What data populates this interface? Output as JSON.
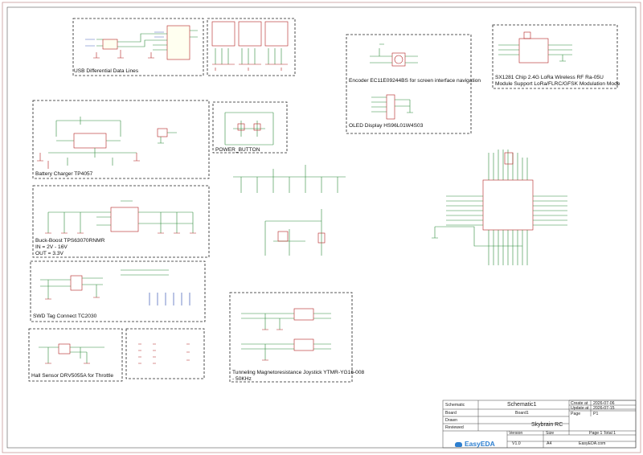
{
  "blocks": {
    "usb": "USB Differential Data Lines",
    "battery": "Battery Charger TP4057",
    "power_button": "POWER_BUTTON",
    "buck_boost_1": "Buck-Boost TPS63070RNMR",
    "buck_boost_2": "IN = 2V - 16V",
    "buck_boost_3": "OUT = 3.3V",
    "swd": "SWD Tag Connect TC2030",
    "hall": "Hall Sensor DRV5055A for Throttle",
    "joystick_1": "Tunneling Magnetoresistance Joystick YTMR-YG16-008",
    "joystick_2": "- 50KHz",
    "encoder": "Encoder EC11E09244BS for screen interface navigation",
    "oled": "OLED Display HS96L01W4S03",
    "lora_1": "SX1281 Chip 2.4G LoRa Wireless RF Ra-05U",
    "lora_2": "Module Support LoRa/FLRC/GFSK Modulation Mode"
  },
  "title_block": {
    "schematic_label": "Schematic",
    "schematic_value": "Schematic1",
    "board_label": "Board",
    "board_value": "Board1",
    "drawn_label": "Drawn",
    "reviewed_label": "Reviewed",
    "project": "Skybrain RC",
    "create_label": "Create at",
    "create_value": "2026-07-06",
    "update_label": "Update at",
    "update_value": "2026-07-15",
    "page_label": "Page",
    "page_value": "P1",
    "version_label": "Version",
    "version_value": "V1.0",
    "size_label": "Size",
    "size_value": "A4",
    "pages": "Page  1  Total  1",
    "site": "EasyEDA.com",
    "brand": "EasyEDA"
  },
  "colors": {
    "border": "#c89a9a",
    "frame": "#555555",
    "wire": "#2e8b3a",
    "component": "#b22222",
    "net_label": "#1a3da8",
    "brand": "#2d7fd0"
  }
}
